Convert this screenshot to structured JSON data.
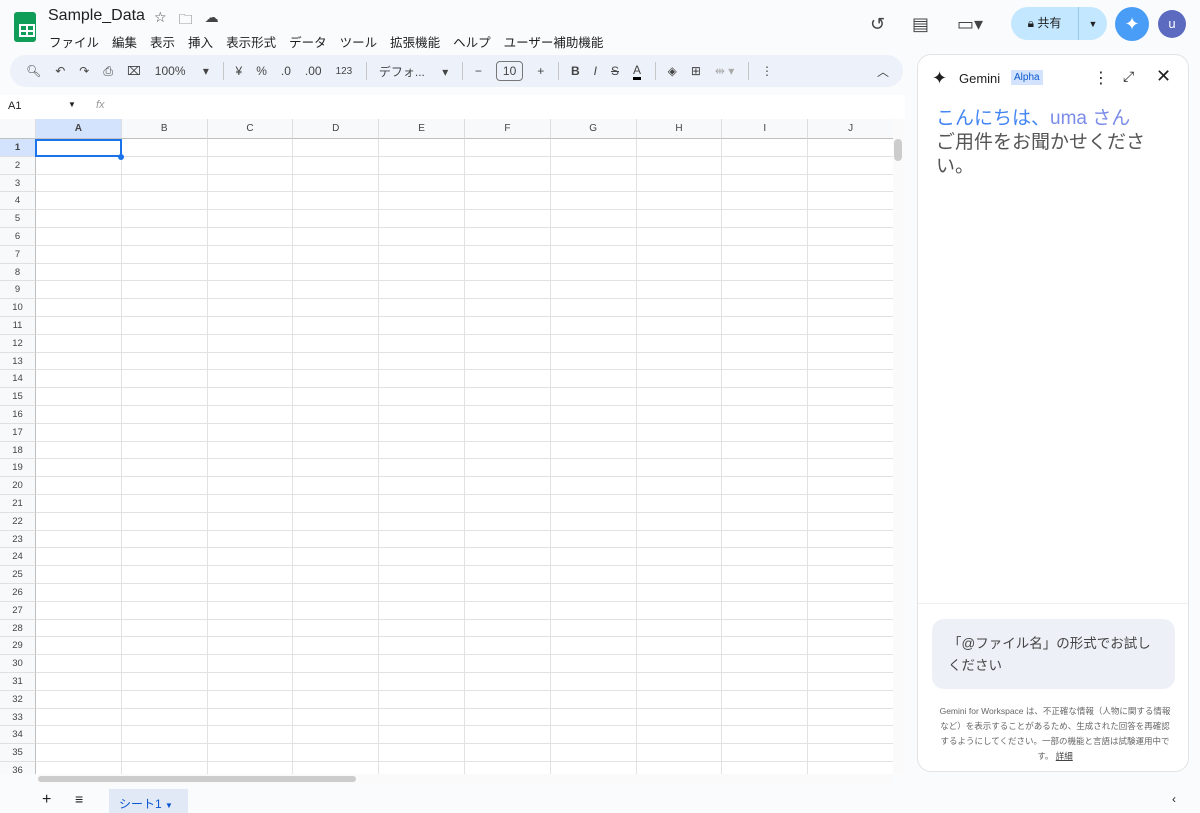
{
  "header": {
    "title": "Sample_Data",
    "menu": [
      "ファイル",
      "編集",
      "表示",
      "挿入",
      "表示形式",
      "データ",
      "ツール",
      "拡張機能",
      "ヘルプ",
      "ユーザー補助機能"
    ],
    "share_label": "共有",
    "avatar": "u"
  },
  "toolbar": {
    "zoom": "100%",
    "currency": "¥",
    "percent": "%",
    "dec_less": ".0",
    "dec_more": ".00",
    "format": "123",
    "font": "デフォ...",
    "font_size": "10",
    "bold": "B",
    "italic": "I",
    "strike": "S",
    "color": "A"
  },
  "formula": {
    "cell_ref": "A1",
    "fx": "fx",
    "value": ""
  },
  "grid": {
    "columns": [
      "A",
      "B",
      "C",
      "D",
      "E",
      "F",
      "G",
      "H",
      "I",
      "J"
    ],
    "rows": [
      "1",
      "2",
      "3",
      "4",
      "5",
      "6",
      "7",
      "8",
      "9",
      "10",
      "11",
      "12",
      "13",
      "14",
      "15",
      "16",
      "17",
      "18",
      "19",
      "20",
      "21",
      "22",
      "23",
      "24",
      "25",
      "26",
      "27",
      "28",
      "29",
      "30",
      "31",
      "32",
      "33",
      "34",
      "35",
      "36"
    ],
    "selected": "A1"
  },
  "sheets": {
    "tabs": [
      "シート1"
    ]
  },
  "gemini": {
    "title": "Gemini",
    "badge": "Alpha",
    "greet1": "こんにちは、",
    "greet_name": "uma さん",
    "greet2": "ご用件をお聞かせください。",
    "prompt_placeholder": "「@ファイル名」の形式でお試しください",
    "disclaimer": "Gemini for Workspace は、不正確な情報（人物に関する情報など）を表示することがあるため、生成された回答を再確認するようにしてください。一部の機能と言語は試験運用中です。",
    "details_link": "詳細"
  },
  "colors": {
    "accent": "#1a73e8",
    "share_bg": "#c2e7ff",
    "sheets_green": "#0f9d58"
  }
}
